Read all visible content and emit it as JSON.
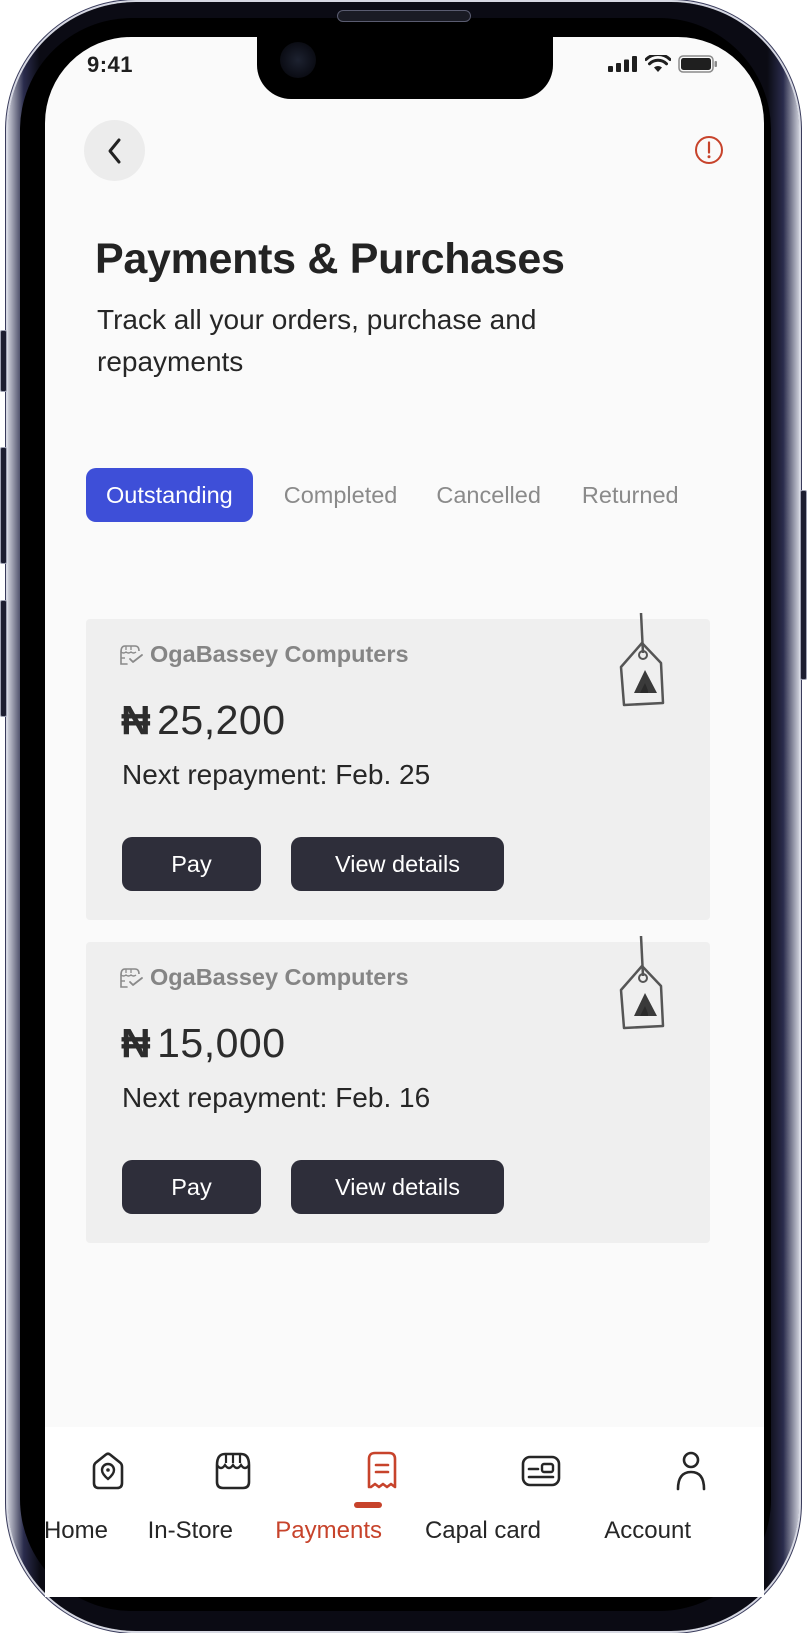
{
  "status_bar": {
    "time": "9:41",
    "icons": [
      "cellular-signal-icon",
      "wifi-icon",
      "battery-icon"
    ]
  },
  "header": {
    "back_icon": "chevron-left-icon",
    "info_icon": "alert-circle-icon",
    "title": "Payments & Purchases",
    "subtitle": "Track all your orders, purchase and repayments"
  },
  "tabs": [
    {
      "label": "Outstanding",
      "active": true
    },
    {
      "label": "Completed",
      "active": false
    },
    {
      "label": "Cancelled",
      "active": false
    },
    {
      "label": "Returned",
      "active": false
    }
  ],
  "orders": [
    {
      "merchant": "OgaBassey Computers",
      "merchant_icon": "store-check-icon",
      "currency_symbol": "₦",
      "amount": "25,200",
      "next_repayment": "Next repayment: Feb. 25",
      "pay_label": "Pay",
      "details_label": "View details",
      "tag_icon": "price-tag-icon"
    },
    {
      "merchant": "OgaBassey Computers",
      "merchant_icon": "store-check-icon",
      "currency_symbol": "₦",
      "amount": "15,000",
      "next_repayment": "Next repayment: Feb. 16",
      "pay_label": "Pay",
      "details_label": "View details",
      "tag_icon": "price-tag-icon"
    }
  ],
  "bottom_nav": {
    "items": [
      {
        "label": "Home",
        "icon": "home-location-icon",
        "active": false
      },
      {
        "label": "In-Store",
        "icon": "storefront-icon",
        "active": false
      },
      {
        "label": "Payments",
        "icon": "receipt-icon",
        "active": true
      },
      {
        "label": "Capal card",
        "icon": "card-icon",
        "active": false
      },
      {
        "label": "Account",
        "icon": "user-icon",
        "active": false
      }
    ]
  },
  "colors": {
    "accent_blue": "#3e4fd8",
    "active_red": "#c7432b",
    "button_dark": "#2e2e3a",
    "card_bg": "#efefef"
  }
}
